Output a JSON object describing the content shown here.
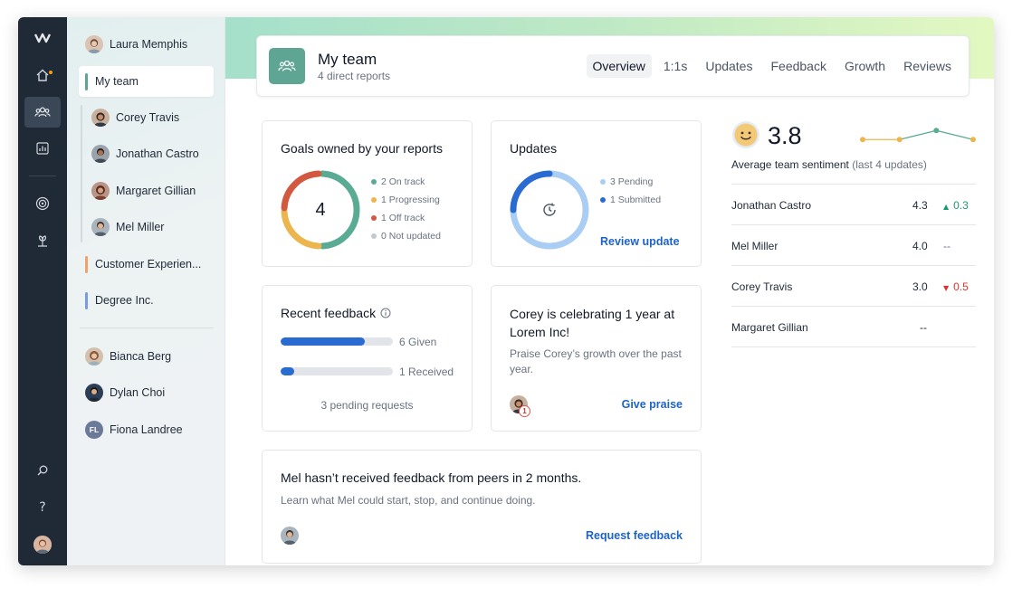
{
  "rail": {
    "items": [
      {
        "name": "home-icon"
      },
      {
        "name": "team-icon"
      },
      {
        "name": "reports-icon"
      },
      {
        "name": "goals-icon"
      },
      {
        "name": "growth-icon"
      },
      {
        "name": "search-icon"
      },
      {
        "name": "help-icon"
      }
    ]
  },
  "sidebar": {
    "manager": "Laura Memphis",
    "my_team": "My team",
    "reports": [
      "Corey Travis",
      "Jonathan Castro",
      "Margaret Gillian",
      "Mel Miller"
    ],
    "groups": [
      "Customer Experien...",
      "Degree Inc."
    ],
    "others": [
      "Bianca Berg",
      "Dylan Choi",
      "Fiona Landree"
    ],
    "fiona_initials": "FL",
    "group_colors": [
      "#f0a26b",
      "#7b9be0"
    ]
  },
  "header": {
    "title": "My team",
    "subtitle": "4 direct reports",
    "tabs": [
      "Overview",
      "1:1s",
      "Updates",
      "Feedback",
      "Growth",
      "Reviews"
    ]
  },
  "goals": {
    "title": "Goals owned by your reports",
    "total": "4",
    "legend": [
      "2 On track",
      "1 Progressing",
      "1 Off track",
      "0 Not updated"
    ],
    "values": [
      2,
      1,
      1,
      0
    ],
    "colors": [
      "#5aab93",
      "#ecb54d",
      "#d2583f",
      "#c4c9ce"
    ]
  },
  "updates": {
    "title": "Updates",
    "legend": [
      "3 Pending",
      "1 Submitted"
    ],
    "values": [
      3,
      1
    ],
    "colors": [
      "#a9cdf3",
      "#2a6bd1"
    ],
    "action": "Review update"
  },
  "feedback": {
    "title": "Recent feedback",
    "given": "6 Given",
    "received": "1 Received",
    "given_fraction": 0.75,
    "received_fraction": 0.12,
    "pending": "3 pending requests"
  },
  "celebration": {
    "title": "Corey is celebrating 1 year at Lorem Inc!",
    "body": "Praise Corey’s growth over the past year.",
    "badge": "1",
    "action": "Give praise"
  },
  "peer": {
    "title": "Mel hasn’t received feedback from peers in 2 months.",
    "body": "Learn what Mel could start, stop, and continue doing.",
    "action": "Request feedback"
  },
  "sentiment": {
    "score": "3.8",
    "label": "Average team sentiment",
    "label_suffix": "(last 4 updates)",
    "trend": [
      3.2,
      3.2,
      3.9,
      3.2
    ],
    "rows": [
      {
        "name": "Jonathan Castro",
        "score": "4.3",
        "arrow": "▲",
        "delta": "0.3",
        "color": "#1a9a6c"
      },
      {
        "name": "Mel Miller",
        "score": "4.0",
        "arrow": "",
        "delta": "--",
        "color": "#6b7280"
      },
      {
        "name": "Corey Travis",
        "score": "3.0",
        "arrow": "▼",
        "delta": "0.5",
        "color": "#d9342b"
      },
      {
        "name": "Margaret Gillian",
        "score": "--",
        "arrow": "",
        "delta": "",
        "color": "#6b7280"
      }
    ]
  }
}
